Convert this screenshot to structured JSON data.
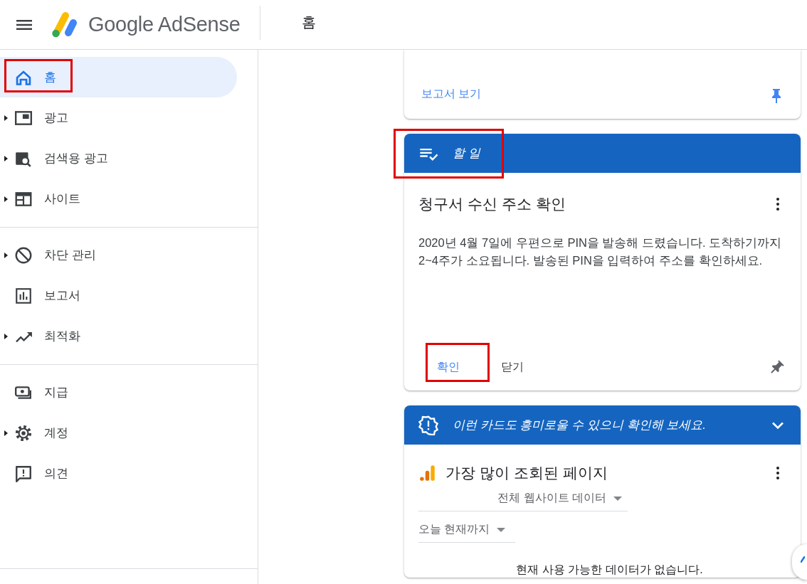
{
  "header": {
    "product_name": "Google AdSense",
    "page_title": "홈"
  },
  "sidebar": {
    "groups": [
      {
        "items": [
          {
            "label": "홈",
            "selected": true,
            "expandable": false,
            "highlighted": true
          },
          {
            "label": "광고",
            "selected": false,
            "expandable": true,
            "highlighted": false
          },
          {
            "label": "검색용 광고",
            "selected": false,
            "expandable": true,
            "highlighted": false
          },
          {
            "label": "사이트",
            "selected": false,
            "expandable": true,
            "highlighted": false
          }
        ]
      },
      {
        "items": [
          {
            "label": "차단 관리",
            "selected": false,
            "expandable": true,
            "highlighted": false
          },
          {
            "label": "보고서",
            "selected": false,
            "expandable": false,
            "highlighted": false
          },
          {
            "label": "최적화",
            "selected": false,
            "expandable": true,
            "highlighted": false
          }
        ]
      },
      {
        "items": [
          {
            "label": "지급",
            "selected": false,
            "expandable": false,
            "highlighted": false
          },
          {
            "label": "계정",
            "selected": false,
            "expandable": true,
            "highlighted": false
          },
          {
            "label": "의견",
            "selected": false,
            "expandable": false,
            "highlighted": false
          }
        ]
      }
    ]
  },
  "cards": [
    {
      "kind": "tail",
      "link": "보고서 보기",
      "pinned": true
    },
    {
      "kind": "task",
      "header": "할 일",
      "header_highlighted": true,
      "title": "청구서 수신 주소 확인",
      "body": "2020년 4월 7일에 우편으로 PIN을 발송해 드렸습니다. 도착하기까지 2~4주가 소요됩니다. 발송된 PIN을 입력하여 주소를 확인하세요.",
      "actions": [
        {
          "label": "확인",
          "primary": true,
          "highlighted": true
        },
        {
          "label": "닫기",
          "primary": false,
          "highlighted": false
        }
      ],
      "pinned": false
    },
    {
      "kind": "suggestion",
      "header": "이런 카드도 흥미로울 수 있으니 확인해 보세요.",
      "expanded": true,
      "title": "가장 많이 조회된 페이지",
      "filters": [
        "전체 웹사이트 데이터",
        "오늘 현재까지"
      ],
      "empty_message": "현재 사용 가능한 데이터가 없습니다."
    }
  ]
}
